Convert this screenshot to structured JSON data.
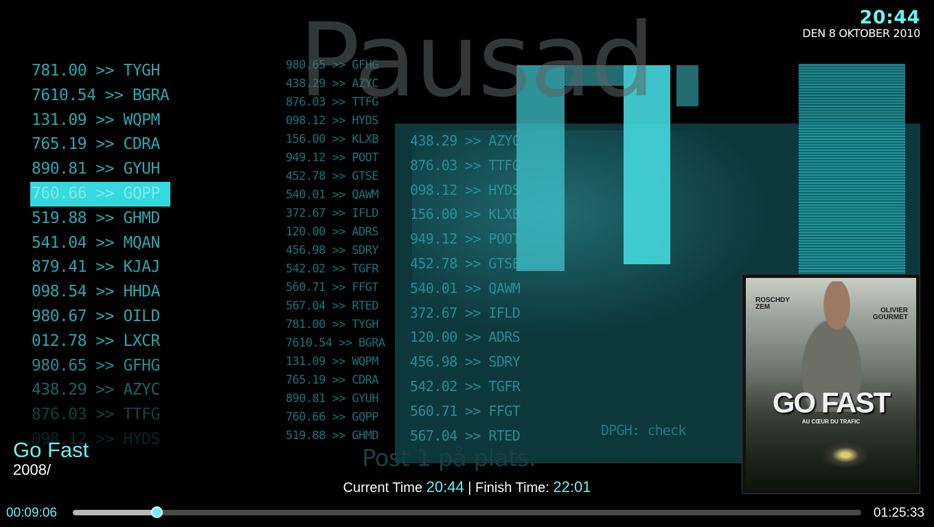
{
  "video": {
    "left_column": [
      "781.00 >> TYGH",
      "7610.54 >> BGRA",
      "131.09 >> WQPM",
      "765.19 >> CDRA",
      "890.81 >> GYUH",
      "760.66 >> GQPP",
      "519.88 >> GHMD",
      "541.04 >> MQAN",
      "879.41 >> KJAJ",
      "098.54 >> HHDA",
      "980.67 >> OILD",
      "012.78 >> LXCR",
      "980.65 >> GFHG",
      "438.29 >> AZYC",
      "876.03 >> TTFG",
      "098.12 >> HYDS"
    ],
    "middle_column": [
      "980.65 >> GFHG",
      "438.29 >> AZYC",
      "876.03 >> TTFG",
      "098.12 >> HYDS",
      "156.00 >> KLXB",
      "949.12 >> POOT",
      "452.78 >> GTSE",
      "540.01 >> QAWM",
      "372.67 >> IFLD",
      "120.00 >> ADRS",
      "456.98 >> SDRY",
      "542.02 >> TGFR",
      "560.71 >> FFGT",
      "567.04 >> RTED",
      "781.00 >> TYGH",
      "7610.54 >> BGRA",
      "131.09 >> WQPM",
      "765.19 >> CDRA",
      "890.81 >> GYUH",
      "760.66 >> GQPP",
      "519.88 >> GHMD"
    ],
    "panel_column": [
      "438.29 >> AZYC",
      "876.03 >> TTFG",
      "098.12 >> HYDS",
      "156.00 >> KLXB",
      "949.12 >> POOT",
      "452.78 >> GTSE",
      "540.01 >> QAWM",
      "372.67 >> IFLD",
      "120.00 >> ADRS",
      "456.98 >> SDRY",
      "542.02 >> TGFR",
      "560.71 >> FFGT",
      "567.04 >> RTED"
    ],
    "panel_text": "DPGH: check",
    "subtitle": "Post 1 på plats."
  },
  "status": {
    "paused_label": "Pausad",
    "clock": "20:44",
    "date": "DEN 8 OKTOBER 2010"
  },
  "media": {
    "title": "Go Fast",
    "year": "2008/",
    "poster": {
      "actor1": "ROSCHDY ZEM",
      "actor2": "OLIVIER GOURMET",
      "title": "GO FAST",
      "tagline": "AU CŒUR DU TRAFIC"
    }
  },
  "times": {
    "current_label": "Current Time",
    "current_value": "20:44",
    "separator": "|",
    "finish_label": "Finish Time:",
    "finish_value": "22:01",
    "elapsed": "00:09:06",
    "total": "01:25:33",
    "progress_fraction": 0.106
  },
  "colors": {
    "accent": "#6ff0f4",
    "highlight": "#35d8de"
  }
}
